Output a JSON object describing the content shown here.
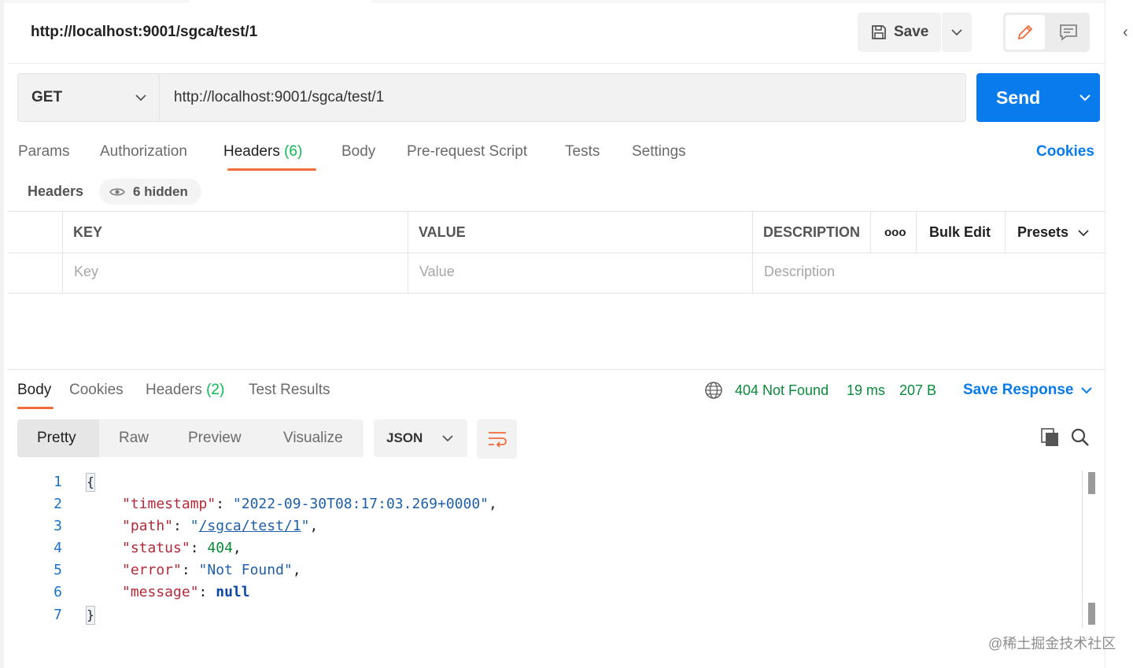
{
  "request": {
    "title": "http://localhost:9001/sgca/test/1",
    "save_label": "Save",
    "method": "GET",
    "url": "http://localhost:9001/sgca/test/1",
    "send_label": "Send"
  },
  "request_tabs": {
    "params": "Params",
    "authorization": "Authorization",
    "headers": "Headers",
    "headers_count": "(6)",
    "body": "Body",
    "pre_request": "Pre-request Script",
    "tests": "Tests",
    "settings": "Settings",
    "cookies": "Cookies"
  },
  "headers_panel": {
    "label": "Headers",
    "hidden_label": "6 hidden",
    "col_key": "KEY",
    "col_value": "VALUE",
    "col_description": "DESCRIPTION",
    "more_label": "ooo",
    "bulk_edit": "Bulk Edit",
    "presets": "Presets",
    "key_placeholder": "Key",
    "value_placeholder": "Value",
    "description_placeholder": "Description"
  },
  "response": {
    "tabs": {
      "body": "Body",
      "cookies": "Cookies",
      "headers": "Headers",
      "headers_count": "(2)",
      "test_results": "Test Results"
    },
    "status": "404 Not Found",
    "time": "19 ms",
    "size": "207 B",
    "save_response": "Save Response",
    "views": {
      "pretty": "Pretty",
      "raw": "Raw",
      "preview": "Preview",
      "visualize": "Visualize"
    },
    "format": "JSON",
    "body_lines": {
      "open": "{",
      "close": "}",
      "timestamp_key": "\"timestamp\"",
      "timestamp_val": "\"2022-09-30T08:17:03.269+0000\"",
      "path_key": "\"path\"",
      "path_val": "/sgca/test/1",
      "status_key": "\"status\"",
      "status_val": "404",
      "error_key": "\"error\"",
      "error_val": "\"Not Found\"",
      "message_key": "\"message\"",
      "message_val": "null"
    },
    "line_numbers": [
      "1",
      "2",
      "3",
      "4",
      "5",
      "6",
      "7"
    ]
  },
  "watermark": "@稀土掘金技术社区",
  "colors": {
    "accent_blue": "#097bed",
    "active_underline": "#f26b3a",
    "status_green": "#0a8a3a",
    "count_green": "#0cbb52"
  }
}
